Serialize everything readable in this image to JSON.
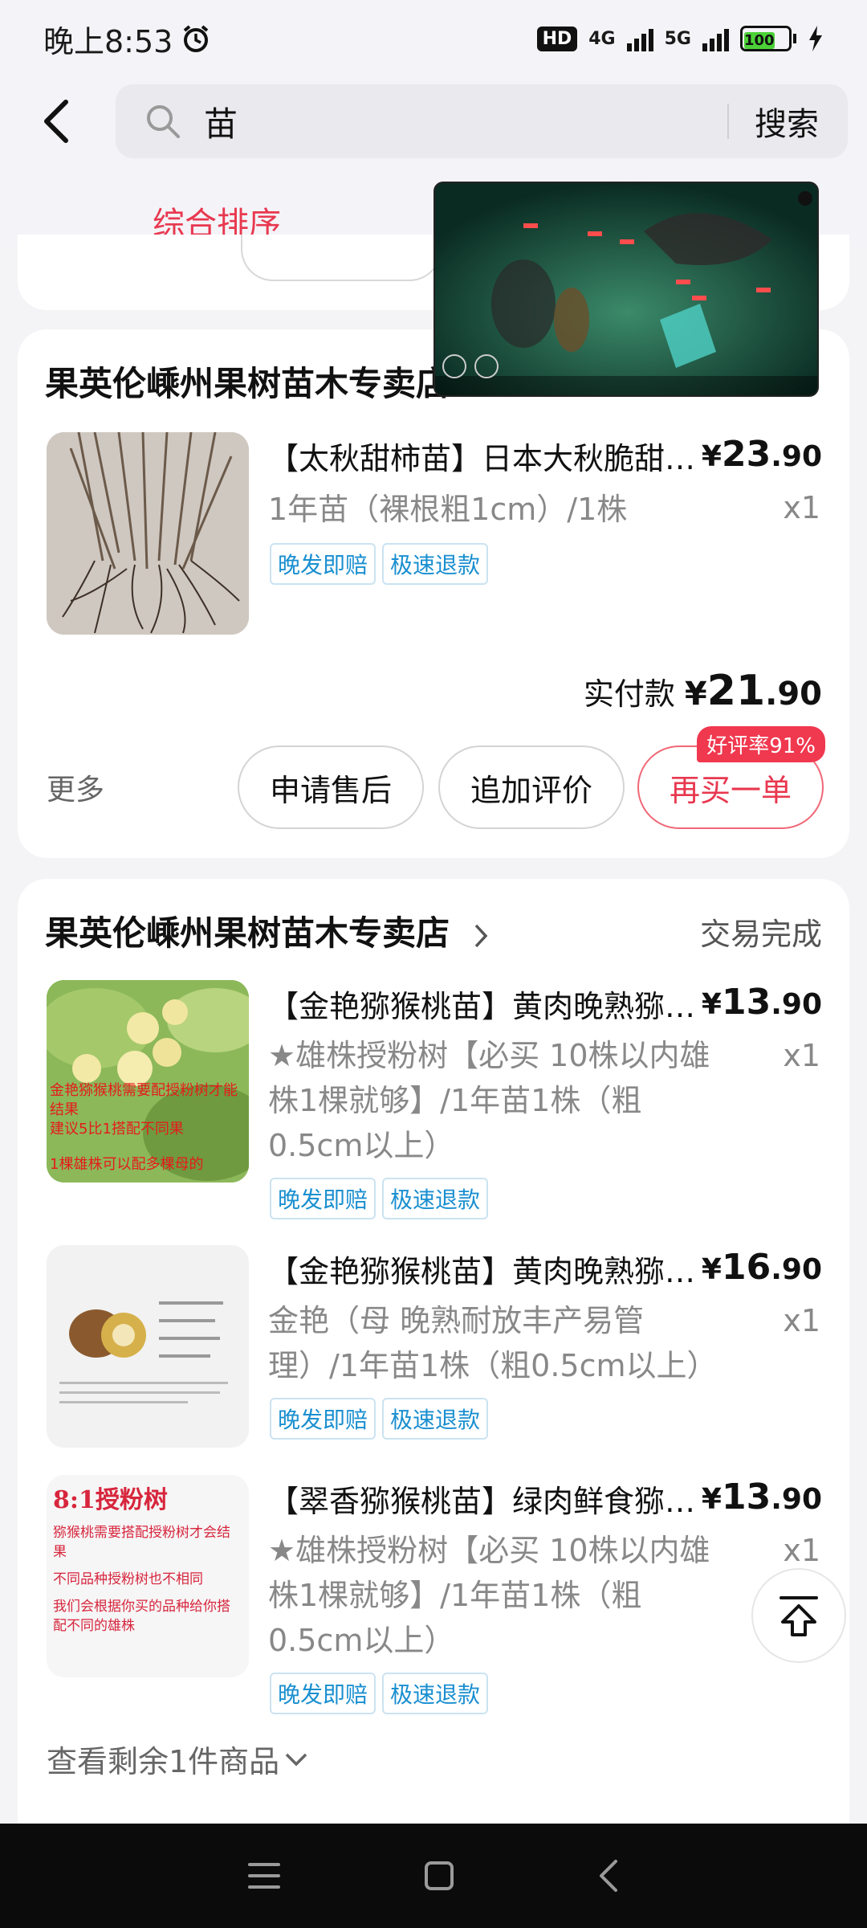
{
  "status_bar": {
    "time": "晚上8:53",
    "hd_label": "HD",
    "net1": "4G",
    "net2": "5G",
    "battery": "100"
  },
  "search": {
    "query": "苗",
    "button_label": "搜索"
  },
  "sort": {
    "active_label": "综合排序"
  },
  "order1": {
    "store_name": "果英伦嵊州果树苗木专卖店",
    "item": {
      "title": "【太秋甜柿苗】日本大秋脆甜柿子...",
      "price_yen": "¥",
      "price_int": "23",
      "price_dec": ".90",
      "spec": "1年苗（裸根粗1cm）/1株",
      "qty": "x1",
      "tags": [
        "晚发即赔",
        "极速退款"
      ]
    },
    "paid_label": "实付款",
    "paid_yen": "¥",
    "paid_int": "21",
    "paid_dec": ".90",
    "more_label": "更多",
    "buttons": {
      "after_sale": "申请售后",
      "add_review": "追加评价",
      "rebuy": "再买一单"
    },
    "rating_badge": "好评率91%"
  },
  "order2": {
    "store_name": "果英伦嵊州果树苗木专卖店",
    "status": "交易完成",
    "items": [
      {
        "title": "【金艳猕猴桃苗】黄肉晚熟猕猴桃...",
        "price_yen": "¥",
        "price_int": "13",
        "price_dec": ".90",
        "spec": "★雄株授粉树【必买 10株以内雄株1棵就够】/1年苗1株（粗0.5cm以上）",
        "qty": "x1",
        "tags": [
          "晚发即赔",
          "极速退款"
        ],
        "thumb_text": [
          "金艳猕猴桃需要配授粉树才能结果",
          "建议5比1搭配不同果",
          "1棵雄株可以配多棵母的"
        ]
      },
      {
        "title": "【金艳猕猴桃苗】黄肉晚熟猕猴桃...",
        "price_yen": "¥",
        "price_int": "16",
        "price_dec": ".90",
        "spec": "金艳（母 晚熟耐放丰产易管理）/1年苗1株（粗0.5cm以上）",
        "qty": "x1",
        "tags": [
          "晚发即赔",
          "极速退款"
        ]
      },
      {
        "title": "【翠香猕猴桃苗】绿肉鲜食猕猴桃...",
        "price_yen": "¥",
        "price_int": "13",
        "price_dec": ".90",
        "spec": "★雄株授粉树【必买 10株以内雄株1棵就够】/1年苗1株（粗0.5cm以上）",
        "qty": "x1",
        "tags": [
          "晚发即赔",
          "极速退款"
        ],
        "thumb_text": [
          "8:1授粉树",
          "猕猴桃需要搭配授粉树才会结果",
          "不同品种授粉树也不相同",
          "我们会根据你买的品种给你搭配不同的雄株"
        ]
      }
    ],
    "view_more": "查看剩余1件商品"
  },
  "colors": {
    "accent_red": "#e8384f",
    "tag_blue": "#1a8fd0",
    "background": "#f4f4f6"
  },
  "icons": {
    "back": "back-arrow-icon",
    "search": "search-icon",
    "chevron": "chevron-right-icon",
    "scroll_top": "scroll-to-top-icon",
    "nav_menu": "menu-icon",
    "nav_home": "home-icon",
    "nav_back": "nav-back-icon"
  }
}
